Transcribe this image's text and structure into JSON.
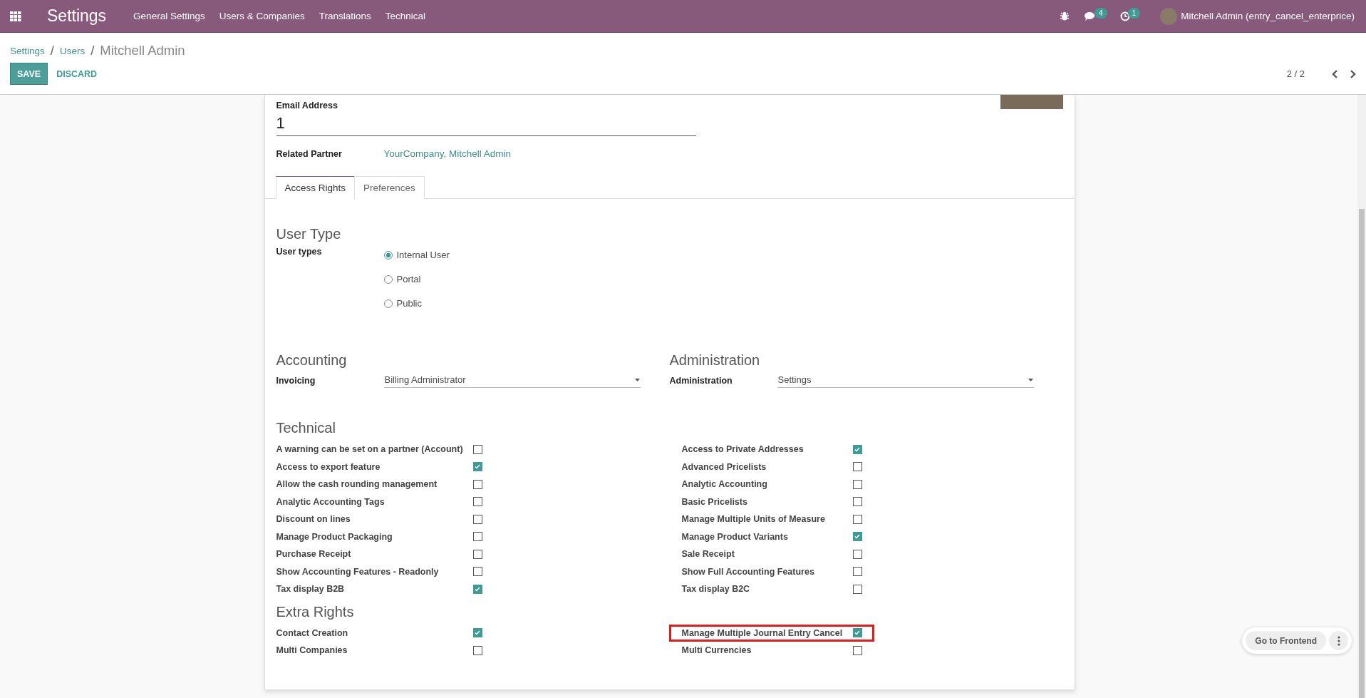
{
  "navbar": {
    "app_title": "Settings",
    "menu": [
      "General Settings",
      "Users & Companies",
      "Translations",
      "Technical"
    ],
    "messages_count": "4",
    "activities_count": "1",
    "user": "Mitchell Admin (entry_cancel_enterprice)"
  },
  "breadcrumbs": [
    {
      "label": "Settings",
      "link": true
    },
    {
      "separator": "/",
      "label": "Users",
      "link": true
    },
    {
      "separator": "/",
      "label": "Mitchell Admin",
      "link": false
    }
  ],
  "buttons": {
    "save": "SAVE",
    "discard": "DISCARD"
  },
  "pager": "2 / 2",
  "form": {
    "email_label": "Email Address",
    "email_value": "1",
    "partner_label": "Related Partner",
    "partner_value": "YourCompany, Mitchell Admin"
  },
  "tabs": [
    {
      "label": "Access Rights",
      "selected": true
    },
    {
      "label": "Preferences",
      "selected": false
    }
  ],
  "user_type": {
    "heading": "User Type",
    "label": "User types",
    "options": [
      {
        "label": "Internal User",
        "selected": true
      },
      {
        "label": "Portal",
        "selected": false
      },
      {
        "label": "Public",
        "selected": false
      }
    ]
  },
  "groups": [
    {
      "heading": "Accounting",
      "label": "Invoicing",
      "value": "Billing Administrator"
    },
    {
      "heading": "Administration",
      "label": "Administration",
      "value": "Settings"
    }
  ],
  "technical": {
    "heading": "Technical",
    "left": [
      {
        "label": "A warning can be set on a partner (Account)",
        "checked": false
      },
      {
        "label": "Access to export feature",
        "checked": true
      },
      {
        "label": "Allow the cash rounding management",
        "checked": false
      },
      {
        "label": "Analytic Accounting Tags",
        "checked": false
      },
      {
        "label": "Discount on lines",
        "checked": false
      },
      {
        "label": "Manage Product Packaging",
        "checked": false
      },
      {
        "label": "Purchase Receipt",
        "checked": false
      },
      {
        "label": "Show Accounting Features - Readonly",
        "checked": false
      },
      {
        "label": "Tax display B2B",
        "checked": true
      }
    ],
    "right": [
      {
        "label": "Access to Private Addresses",
        "checked": true
      },
      {
        "label": "Advanced Pricelists",
        "checked": false
      },
      {
        "label": "Analytic Accounting",
        "checked": false
      },
      {
        "label": "Basic Pricelists",
        "checked": false
      },
      {
        "label": "Manage Multiple Units of Measure",
        "checked": false
      },
      {
        "label": "Manage Product Variants",
        "checked": true
      },
      {
        "label": "Sale Receipt",
        "checked": false
      },
      {
        "label": "Show Full Accounting Features",
        "checked": false
      },
      {
        "label": "Tax display B2C",
        "checked": false
      }
    ]
  },
  "extra_rights": {
    "heading": "Extra Rights",
    "left": [
      {
        "label": "Contact Creation",
        "checked": true,
        "highlighted": false
      },
      {
        "label": "Multi Companies",
        "checked": false,
        "highlighted": false
      }
    ],
    "right": [
      {
        "label": "Manage Multiple Journal Entry Cancel",
        "checked": true,
        "highlighted": true
      },
      {
        "label": "Multi Currencies",
        "checked": false,
        "highlighted": false
      }
    ]
  },
  "frontend_button": "Go to Frontend"
}
